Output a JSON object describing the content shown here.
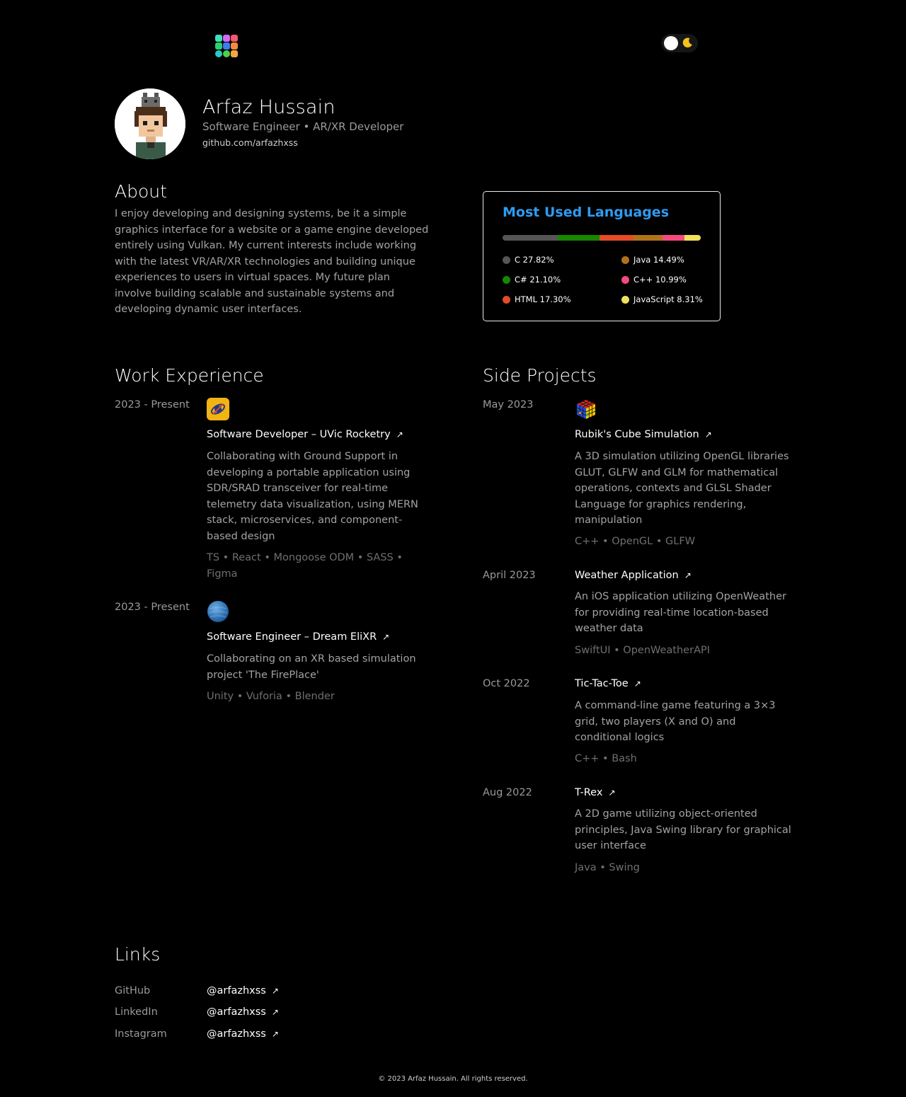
{
  "header": {
    "logo_icon": "grid-logo-icon",
    "theme_toggle": {
      "icon": "moon-icon",
      "mode": "dark"
    }
  },
  "profile": {
    "name": "Arfaz Hussain",
    "subtitle": "Software Engineer • AR/XR Developer",
    "github": "github.com/arfazhxss"
  },
  "about": {
    "heading": "About",
    "text": "I enjoy developing and designing systems, be it a simple graphics interface for a website or a game engine developed entirely using Vulkan. My current interests include working with the latest VR/AR/XR technologies and building unique experiences to users in virtual spaces. My future plan involve building scalable and sustainable systems and developing dynamic user interfaces."
  },
  "languages": {
    "title": "Most Used Languages",
    "items": [
      {
        "label": "C 27.82%",
        "percent": 27.82,
        "color": "#555555"
      },
      {
        "label": "C# 21.10%",
        "percent": 21.1,
        "color": "#178600"
      },
      {
        "label": "HTML 17.30%",
        "percent": 17.3,
        "color": "#e34c26"
      },
      {
        "label": "Java 14.49%",
        "percent": 14.49,
        "color": "#b07219"
      },
      {
        "label": "C++ 10.99%",
        "percent": 10.99,
        "color": "#f34b7d"
      },
      {
        "label": "JavaScript 8.31%",
        "percent": 8.31,
        "color": "#f1e05a"
      }
    ]
  },
  "work": {
    "heading": "Work Experience",
    "entries": [
      {
        "date": "2023 - Present",
        "icon": "rocketry-logo-icon",
        "title": "Software Developer – UVic Rocketry",
        "description": "Collaborating with Ground Support in developing a portable application using SDR/SRAD transceiver for real-time telemetry data visualization, using MERN stack, microservices, and component-based design",
        "tags": "TS • React • Mongoose ODM • SASS • Figma"
      },
      {
        "date": "2023 - Present",
        "icon": "dream-elixr-logo-icon",
        "title": "Software Engineer – Dream EliXR",
        "description": "Collaborating on an XR based simulation project 'The FirePlace'",
        "tags": "Unity • Vuforia • Blender"
      }
    ]
  },
  "projects": {
    "heading": "Side Projects",
    "entries": [
      {
        "date": "May 2023",
        "icon": "rubiks-cube-icon",
        "title": "Rubik's Cube Simulation",
        "description": "A 3D simulation utilizing OpenGL libraries GLUT, GLFW and GLM for mathematical operations, contexts and GLSL Shader Language for graphics rendering, manipulation",
        "tags": "C++ • OpenGL • GLFW"
      },
      {
        "date": "April 2023",
        "title": "Weather Application",
        "description": "An iOS application utilizing OpenWeather for providing real-time location-based weather data",
        "tags": "SwiftUI • OpenWeatherAPI"
      },
      {
        "date": "Oct 2022",
        "title": "Tic-Tac-Toe",
        "description": "A command-line game featuring a 3×3 grid, two players (X and O) and conditional logics",
        "tags": "C++ • Bash"
      },
      {
        "date": "Aug 2022",
        "title": "T-Rex",
        "description": "A 2D game utilizing object-oriented principles, Java Swing library for graphical user interface",
        "tags": "Java • Swing"
      }
    ]
  },
  "links": {
    "heading": "Links",
    "items": [
      {
        "label": "GitHub",
        "value": "@arfazhxss"
      },
      {
        "label": "LinkedIn",
        "value": "@arfazhxss"
      },
      {
        "label": "Instagram",
        "value": "@arfazhxss"
      }
    ]
  },
  "footer": {
    "text": "© 2023 Arfaz Hussain. All rights reserved."
  },
  "glyphs": {
    "external_arrow": "↗"
  }
}
